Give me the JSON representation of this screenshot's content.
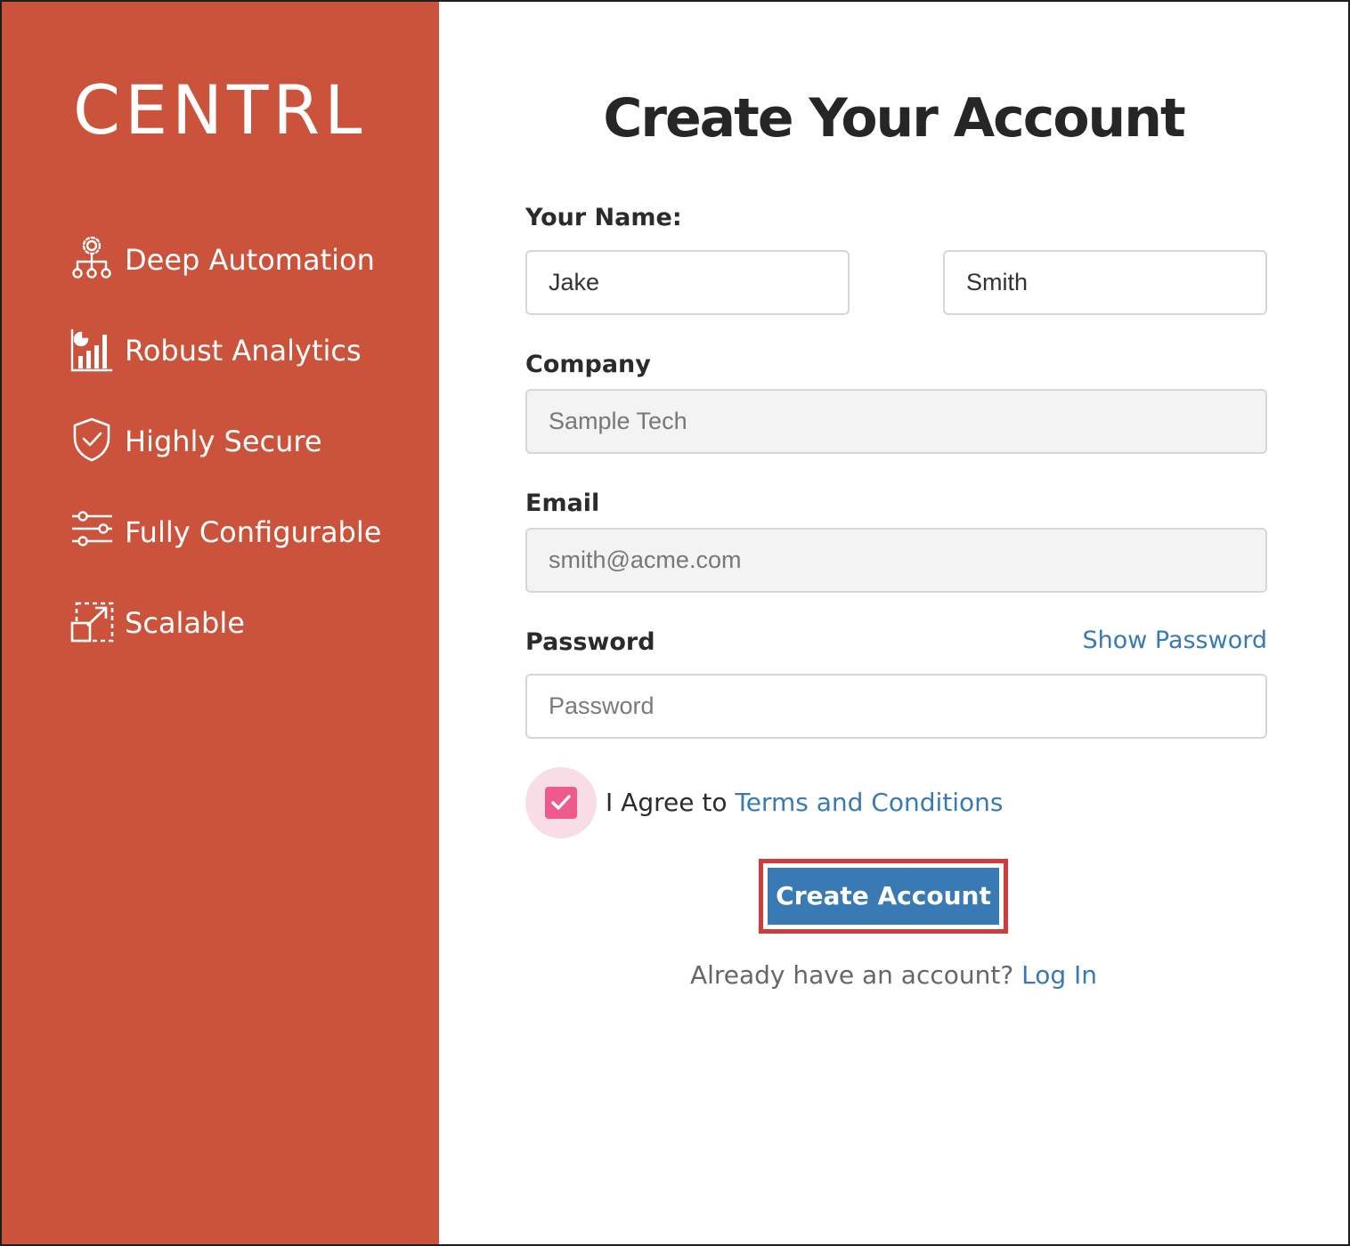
{
  "brand": {
    "logo_text": "CENTRL",
    "sidebar_color": "#cc533b",
    "accent": "#3a7ab4"
  },
  "features": [
    {
      "label": "Deep Automation",
      "icon": "automation-icon"
    },
    {
      "label": "Robust Analytics",
      "icon": "analytics-icon"
    },
    {
      "label": "Highly Secure",
      "icon": "shield-check-icon"
    },
    {
      "label": "Fully Configurable",
      "icon": "sliders-icon"
    },
    {
      "label": "Scalable",
      "icon": "scale-icon"
    }
  ],
  "form": {
    "title": "Create Your Account",
    "name_label": "Your Name:",
    "first_name": "Jake",
    "last_name": "Smith",
    "company_label": "Company",
    "company_value": "Sample Tech",
    "email_label": "Email",
    "email_value": "smith@acme.com",
    "password_label": "Password",
    "show_password": "Show Password",
    "password_placeholder": "Password",
    "agree_text": "I Agree to",
    "terms_link": "Terms and Conditions",
    "agree_checked": true,
    "submit_label": "Create Account",
    "login_prompt": "Already have an account?",
    "login_link": "Log In"
  }
}
